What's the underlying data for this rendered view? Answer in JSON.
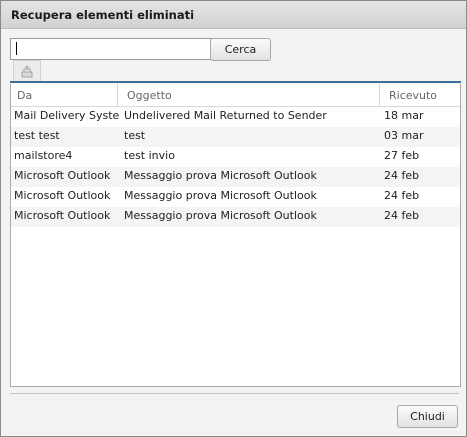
{
  "dialog": {
    "title": "Recupera elementi eliminati"
  },
  "search": {
    "value": "",
    "button_label": "Cerca"
  },
  "toolbar": {
    "restore_icon": "recover-icon"
  },
  "table": {
    "columns": [
      "Da",
      "Oggetto",
      "Ricevuto"
    ],
    "rows": [
      {
        "from": "Mail Delivery System",
        "subject": "Undelivered Mail Returned to Sender",
        "received": "18 mar"
      },
      {
        "from": "test test",
        "subject": "test",
        "received": "03 mar"
      },
      {
        "from": "mailstore4",
        "subject": "test invio",
        "received": "27 feb"
      },
      {
        "from": "Microsoft Outlook",
        "subject": "Messaggio prova Microsoft Outlook",
        "received": "24 feb"
      },
      {
        "from": "Microsoft Outlook",
        "subject": "Messaggio prova Microsoft Outlook",
        "received": "24 feb"
      },
      {
        "from": "Microsoft Outlook",
        "subject": "Messaggio prova Microsoft Outlook",
        "received": "24 feb"
      }
    ]
  },
  "footer": {
    "close_label": "Chiudi"
  },
  "colors": {
    "list_accent": "#3d6f9b"
  }
}
